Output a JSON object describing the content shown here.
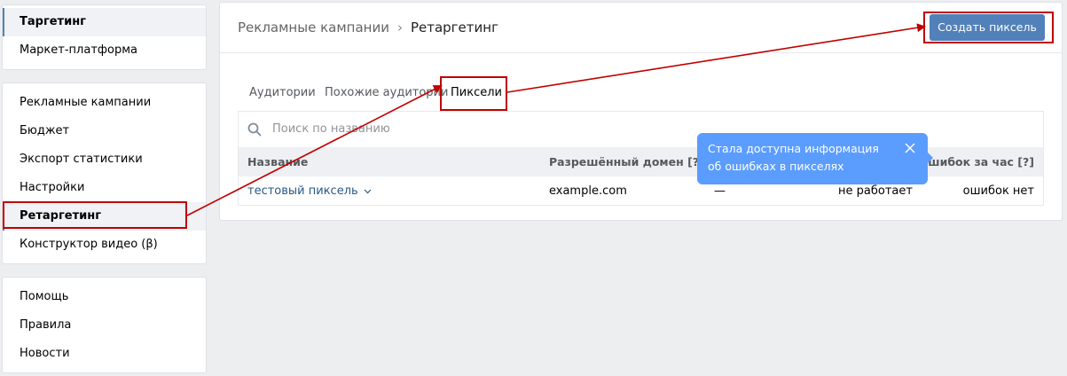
{
  "sidebar": {
    "group1": [
      {
        "label": "Таргетинг",
        "active": true
      },
      {
        "label": "Маркет-платформа"
      }
    ],
    "group2": [
      {
        "label": "Рекламные кампании"
      },
      {
        "label": "Бюджет"
      },
      {
        "label": "Экспорт статистики"
      },
      {
        "label": "Настройки"
      },
      {
        "label": "Ретаргетинг",
        "active": true
      },
      {
        "label": "Конструктор видео (β)"
      }
    ],
    "group3": [
      {
        "label": "Помощь"
      },
      {
        "label": "Правила"
      },
      {
        "label": "Новости"
      }
    ]
  },
  "header": {
    "breadcrumb_parent": "Рекламные кампании",
    "breadcrumb_current": "Ретаргетинг",
    "create_button": "Создать пиксель"
  },
  "tabs": [
    "Аудитории",
    "Похожие аудитории",
    "Пиксели"
  ],
  "active_tab": "Пиксели",
  "search": {
    "placeholder": "Поиск по названию"
  },
  "table": {
    "columns": {
      "name": "Название",
      "domain": "Разрешённый домен [?]",
      "errors": "Ошибок за час [?]"
    },
    "row": {
      "name": "тестовый пиксель",
      "domain": "example.com",
      "col3": "—",
      "status": "не работает",
      "errors": "ошибок нет"
    }
  },
  "tooltip": {
    "line1": "Стала доступна информация",
    "line2": "об ошибках в пикселях"
  },
  "colors": {
    "accent": "#5181b8",
    "link": "#2a5885",
    "tooltip": "#5b9cff",
    "annotation": "#c00000"
  }
}
